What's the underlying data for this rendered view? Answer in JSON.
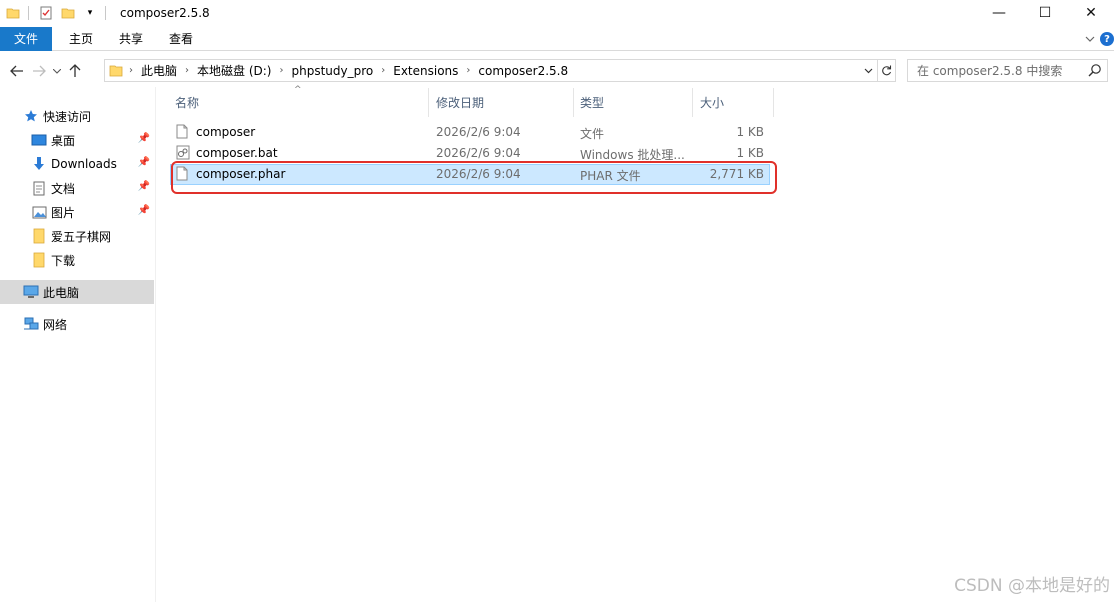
{
  "window": {
    "title": "composer2.5.8",
    "controls": {
      "minimize": "—",
      "maximize": "☐",
      "close": "✕"
    }
  },
  "ribbon": {
    "tabs": [
      "文件",
      "主页",
      "共享",
      "查看"
    ]
  },
  "address": {
    "crumbs": [
      "此电脑",
      "本地磁盘 (D:)",
      "phpstudy_pro",
      "Extensions",
      "composer2.5.8"
    ]
  },
  "search": {
    "placeholder": "在 composer2.5.8 中搜索"
  },
  "sidebar": {
    "items": [
      {
        "label": "快速访问",
        "icon": "star-icon",
        "pinned": false
      },
      {
        "label": "桌面",
        "icon": "desktop-icon",
        "pinned": true
      },
      {
        "label": "Downloads",
        "icon": "download-icon",
        "pinned": true
      },
      {
        "label": "文档",
        "icon": "document-icon",
        "pinned": true
      },
      {
        "label": "图片",
        "icon": "picture-icon",
        "pinned": true
      },
      {
        "label": "爱五子棋网",
        "icon": "folder-icon",
        "pinned": false
      },
      {
        "label": "下载",
        "icon": "folder-icon",
        "pinned": false
      },
      {
        "label": "此电脑",
        "icon": "computer-icon",
        "pinned": false,
        "selected": true
      },
      {
        "label": "网络",
        "icon": "network-icon",
        "pinned": false
      }
    ]
  },
  "columns": {
    "name": "名称",
    "date": "修改日期",
    "type": "类型",
    "size": "大小"
  },
  "files": [
    {
      "name": "composer",
      "date": "2026/2/6 9:04",
      "type": "文件",
      "size": "1 KB",
      "icon": "file-icon"
    },
    {
      "name": "composer.bat",
      "date": "2026/2/6 9:04",
      "type": "Windows 批处理...",
      "size": "1 KB",
      "icon": "batch-file-icon"
    },
    {
      "name": "composer.phar",
      "date": "2026/2/6 9:04",
      "type": "PHAR 文件",
      "size": "2,771 KB",
      "icon": "file-icon",
      "selected": true
    }
  ],
  "watermark": "CSDN @本地是好的",
  "colors": {
    "accent": "#1979ca",
    "selection": "#cce8ff",
    "highlight": "#e0302a"
  }
}
